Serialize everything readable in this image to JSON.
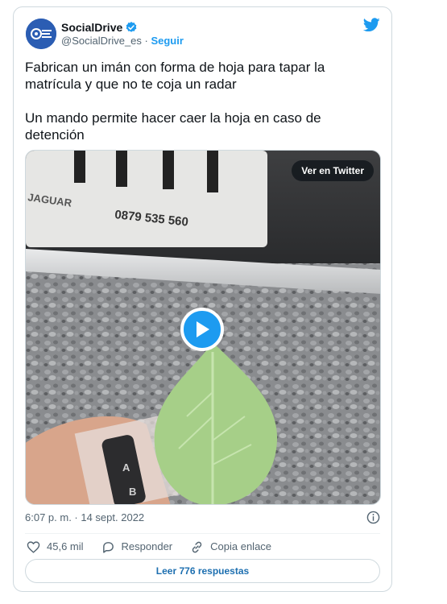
{
  "author": {
    "name": "SocialDrive",
    "handle": "@SocialDrive_es",
    "separator": " · ",
    "follow_label": "Seguir"
  },
  "tweet": {
    "paragraphs": [
      "Fabrican un imán con forma de hoja para tapar la matrícula y que no te coja un radar",
      "Un mando permite hacer caer la hoja en caso de detención"
    ]
  },
  "media": {
    "view_on_twitter_label": "Ver en Twitter",
    "plate_text": "0879 535 560",
    "brand_text": "JAGUAR",
    "remote_keys": [
      "A",
      "B"
    ]
  },
  "meta": {
    "timestamp": "6:07 p. m. · 14 sept. 2022"
  },
  "actions": {
    "likes": "45,6 mil",
    "reply_label": "Responder",
    "copy_label": "Copia enlace"
  },
  "footer": {
    "read_replies_label": "Leer 776 respuestas"
  },
  "colors": {
    "accent": "#1d9bf0",
    "text": "#0f1419",
    "muted": "#536471",
    "border": "#cfd9de"
  },
  "icons": [
    "avatar-logo",
    "verified-badge-icon",
    "twitter-bird-icon",
    "play-icon",
    "info-icon",
    "heart-icon",
    "reply-icon",
    "link-icon"
  ]
}
